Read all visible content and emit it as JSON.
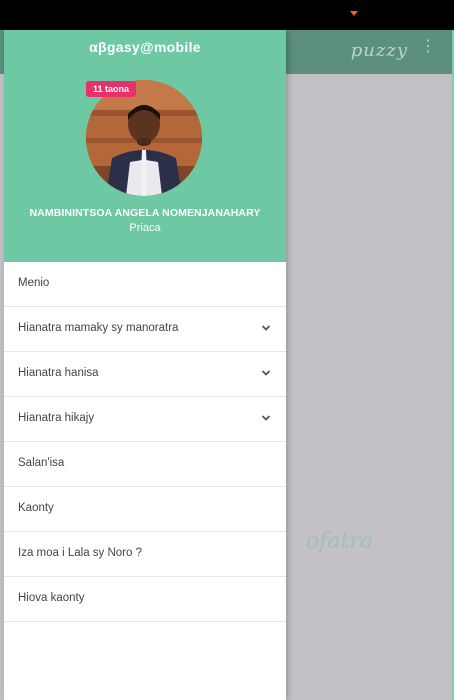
{
  "app": {
    "name": "αβgasy@mobile"
  },
  "background": {
    "toolbar_text": "puzzy",
    "more_icon": "more-vert-icon",
    "script_text": "ofatra"
  },
  "profile": {
    "age_badge": "11 taona",
    "name": "NAMBININTSOA ANGELA NOMENJANAHARY",
    "role": "Priaca"
  },
  "menu": {
    "items": [
      {
        "label": "Menio",
        "has_chevron": false
      },
      {
        "label": "Hianatra mamaky sy manoratra",
        "has_chevron": true
      },
      {
        "label": "Hianatra hanisa",
        "has_chevron": true
      },
      {
        "label": "Hianatra hikajy",
        "has_chevron": true
      },
      {
        "label": "Salan'isa",
        "has_chevron": false
      },
      {
        "label": "Kaonty",
        "has_chevron": false
      },
      {
        "label": "Iza moa i Lala sy Noro ?",
        "has_chevron": false
      },
      {
        "label": "Hiova kaonty",
        "has_chevron": false
      }
    ]
  },
  "colors": {
    "header": "#6dc8a3",
    "badge": "#e8306a",
    "status_bar": "#000000",
    "scrim": "#c3c1c6",
    "bg_toolbar": "#5c8f7e"
  }
}
